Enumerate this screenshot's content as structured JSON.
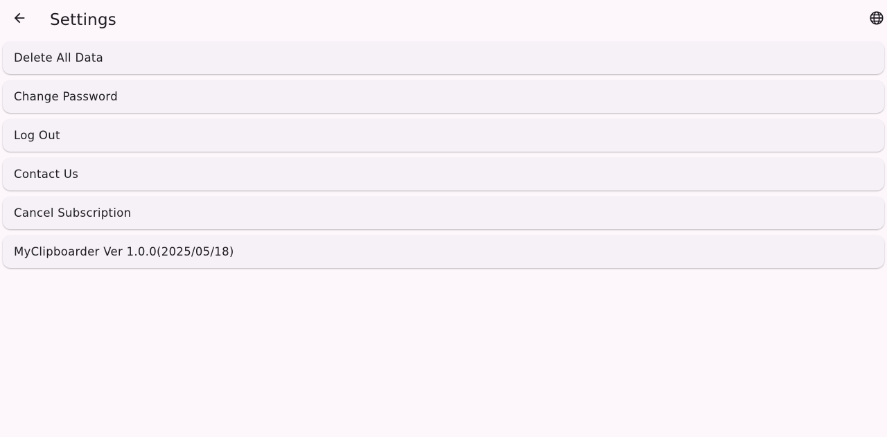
{
  "header": {
    "title": "Settings",
    "back_icon": "arrow-left-icon",
    "language_icon": "globe-icon"
  },
  "settings": {
    "items": [
      {
        "label": "Delete All Data"
      },
      {
        "label": "Change Password"
      },
      {
        "label": "Log Out"
      },
      {
        "label": "Contact Us"
      },
      {
        "label": "Cancel Subscription"
      },
      {
        "label": "MyClipboarder Ver 1.0.0(2025/05/18)"
      }
    ]
  },
  "colors": {
    "background": "#fdf7fc",
    "card": "#f5f1f6",
    "text": "#1d1b20"
  }
}
